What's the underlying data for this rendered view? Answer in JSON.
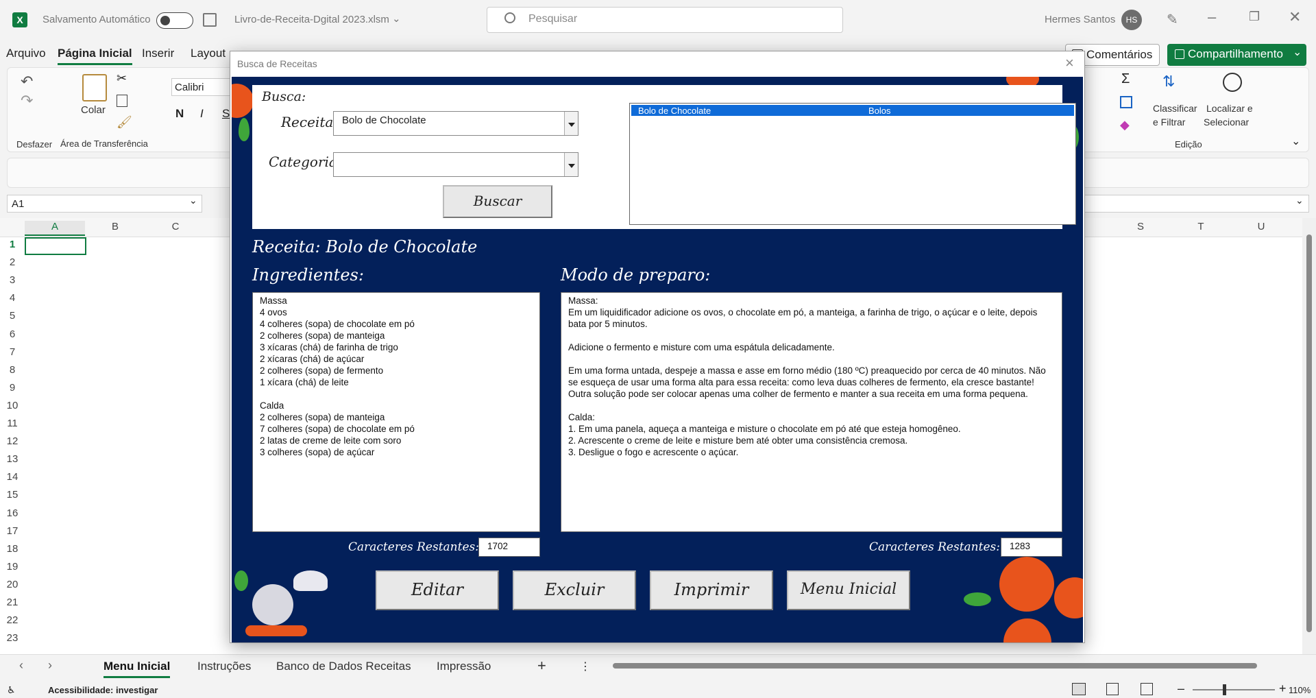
{
  "titlebar": {
    "autosave_label": "Salvamento Automático",
    "filename": "Livro-de-Receita-Dgital 2023.xlsm",
    "search_placeholder": "Pesquisar",
    "user_name": "Hermes Santos",
    "user_initials": "HS"
  },
  "menu": {
    "items": [
      "Arquivo",
      "Página Inicial",
      "Inserir",
      "Layout"
    ],
    "comments": "Comentários",
    "share": "Compartilhamento"
  },
  "ribbon": {
    "undo_group": "Desfazer",
    "paste": "Colar",
    "clipboard_group": "Área de Transferência",
    "font_name": "Calibri",
    "bold": "N",
    "italic": "I",
    "underline": "S",
    "sort_line1": "Classificar",
    "sort_line2": "e Filtrar",
    "find_line1": "Localizar e",
    "find_line2": "Selecionar",
    "edit_group": "Edição"
  },
  "formula": {
    "namebox": "A1"
  },
  "grid": {
    "columns_left": [
      "A",
      "B",
      "C"
    ],
    "columns_right": [
      "S",
      "T",
      "U"
    ],
    "rows": [
      "1",
      "2",
      "3",
      "4",
      "5",
      "6",
      "7",
      "8",
      "9",
      "10",
      "11",
      "12",
      "13",
      "14",
      "15",
      "16",
      "17",
      "18",
      "19",
      "20",
      "21",
      "22",
      "23"
    ]
  },
  "sheets": {
    "tabs": [
      "Menu Inicial",
      "Instruções",
      "Banco de Dados Receitas",
      "Impressão"
    ],
    "add": "+"
  },
  "status": {
    "accessibility": "Acessibilidade: investigar",
    "zoom": "110%"
  },
  "dialog": {
    "title": "Busca de Receitas",
    "search_heading": "Busca:",
    "recipe_label": "Receita:",
    "recipe_value": "Bolo de Chocolate",
    "category_label": "Categoria:",
    "category_value": "",
    "search_button": "Buscar",
    "results": [
      {
        "name": "Bolo de Chocolate",
        "category": "Bolos"
      }
    ],
    "recipe_title": "Receita: Bolo de Chocolate",
    "ingredients_heading": "Ingredientes:",
    "preparation_heading": "Modo de preparo:",
    "ingredients_text": "Massa\n4 ovos\n4 colheres (sopa) de chocolate em pó\n2 colheres (sopa) de manteiga\n3 xícaras (chá) de farinha de trigo\n2 xícaras (chá) de açúcar\n2 colheres (sopa) de fermento\n1 xícara (chá) de leite\n\nCalda\n2 colheres (sopa) de manteiga\n7 colheres (sopa) de chocolate em pó\n2 latas de creme de leite com soro\n3 colheres (sopa) de açúcar",
    "preparation_text": "Massa:\nEm um liquidificador adicione os ovos, o chocolate em pó, a manteiga, a farinha de trigo, o açúcar e o leite, depois bata por 5 minutos.\n\nAdicione o fermento e misture com uma espátula delicadamente.\n\nEm uma forma untada, despeje a massa e asse em forno médio (180 ºC) preaquecido por cerca de 40 minutos. Não se esqueça de usar uma forma alta para essa receita: como leva duas colheres de fermento, ela cresce bastante! Outra solução pode ser colocar apenas uma colher de fermento e manter a sua receita em uma forma pequena.\n\nCalda:\n1. Em uma panela, aqueça a manteiga e misture o chocolate em pó até que esteja homogêneo.\n2. Acrescente o creme de leite e misture bem até obter uma consistência cremosa.\n3. Desligue o fogo e acrescente o açúcar.",
    "chars_label": "Caracteres Restantes:",
    "ingredients_chars": "1702",
    "preparation_chars": "1283",
    "buttons": {
      "edit": "Editar",
      "delete": "Excluir",
      "print": "Imprimir",
      "main_menu": "Menu Inicial"
    }
  },
  "colors": {
    "excel_green": "#107c41",
    "dialog_bg": "#03205a",
    "selection": "#0f6bd8"
  }
}
